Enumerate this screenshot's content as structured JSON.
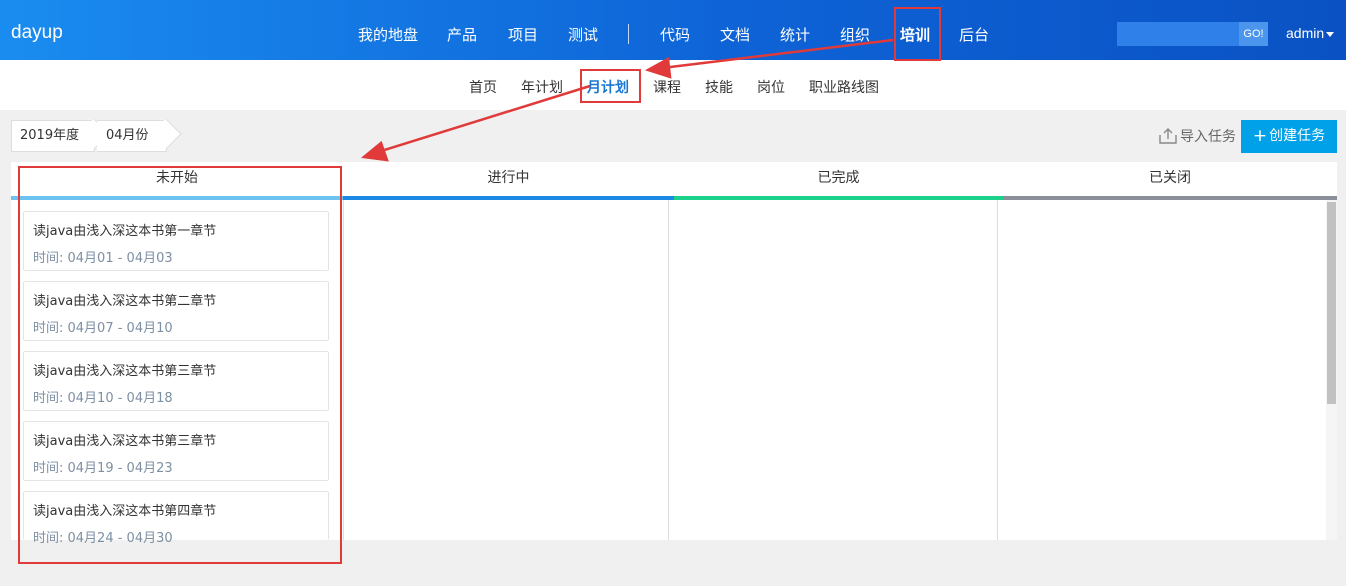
{
  "brand": "dayup",
  "nav": {
    "items": [
      {
        "label": "我的地盘"
      },
      {
        "label": "产品"
      },
      {
        "label": "项目"
      },
      {
        "label": "测试"
      },
      {
        "label": "代码"
      },
      {
        "label": "文档"
      },
      {
        "label": "统计"
      },
      {
        "label": "组织"
      },
      {
        "label": "培训",
        "active": true
      },
      {
        "label": "后台"
      }
    ],
    "search_value": "",
    "search_button": "GO!",
    "user": "admin"
  },
  "subnav": {
    "items": [
      {
        "label": "首页"
      },
      {
        "label": "年计划"
      },
      {
        "label": "月计划",
        "active": true
      },
      {
        "label": "课程"
      },
      {
        "label": "技能"
      },
      {
        "label": "岗位"
      },
      {
        "label": "职业路线图"
      }
    ]
  },
  "filters": {
    "year": "2019年度",
    "month": "04月份"
  },
  "actions": {
    "import": "导入任务",
    "create": "创建任务"
  },
  "columns": [
    {
      "label": "未开始",
      "color": "#6cc3f0"
    },
    {
      "label": "进行中",
      "color": "#1e88e5"
    },
    {
      "label": "已完成",
      "color": "#1bd18b"
    },
    {
      "label": "已关闭",
      "color": "#8a8f99"
    }
  ],
  "cards": [
    {
      "title": "读java由浅入深这本书第一章节",
      "time": "时间: 04月01 - 04月03"
    },
    {
      "title": "读java由浅入深这本书第二章节",
      "time": "时间: 04月07 - 04月10"
    },
    {
      "title": "读java由浅入深这本书第三章节",
      "time": "时间: 04月10 - 04月18"
    },
    {
      "title": "读java由浅入深这本书第三章节",
      "time": "时间: 04月19 - 04月23"
    },
    {
      "title": "读java由浅入深这本书第四章节",
      "time": "时间: 04月24 - 04月30"
    }
  ],
  "annotation_color": "#e03a3a"
}
